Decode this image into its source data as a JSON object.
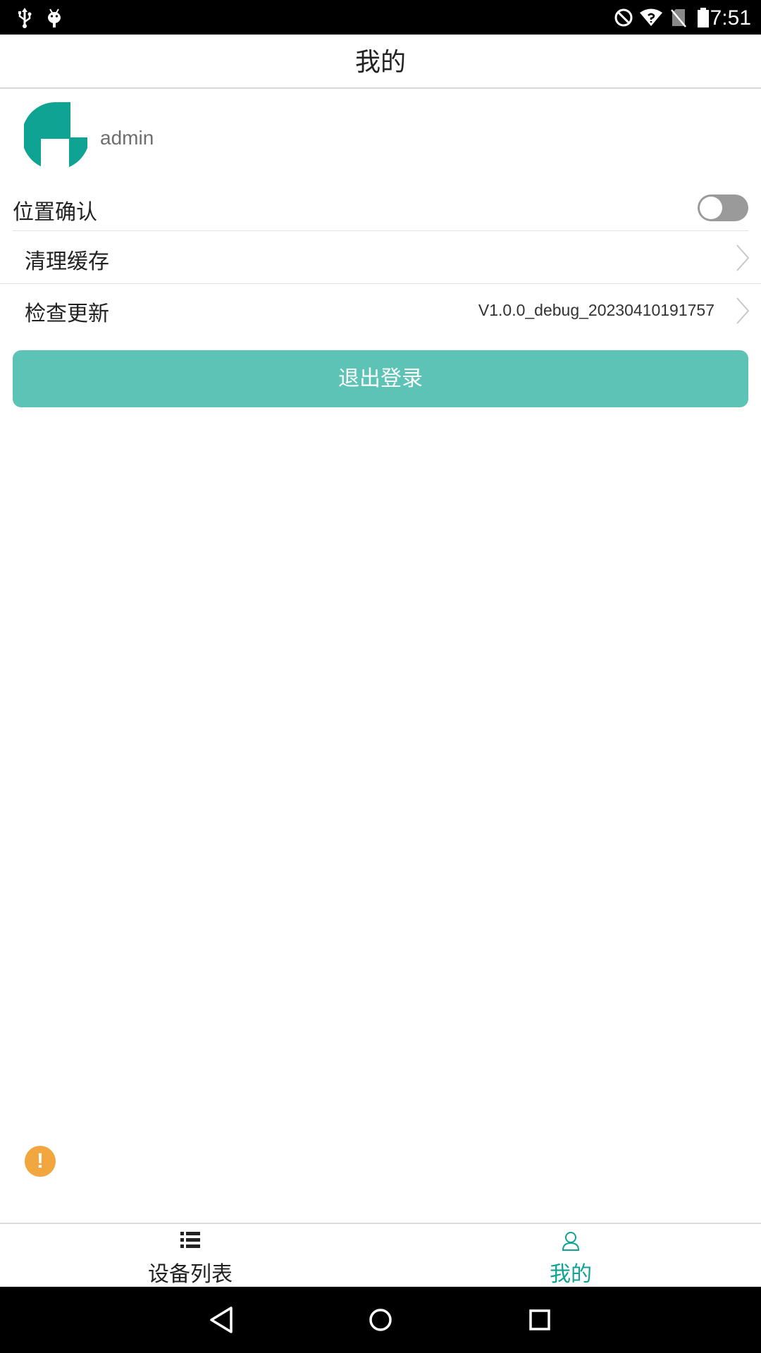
{
  "status_bar": {
    "time": "7:51",
    "left_icons": [
      "usb-icon",
      "android-debug-icon"
    ],
    "right_icons": [
      "do-not-disturb-icon",
      "wifi-icon",
      "no-sim-icon",
      "battery-icon"
    ]
  },
  "header": {
    "title": "我的"
  },
  "profile": {
    "username": "admin",
    "avatar_color": "#0fa394"
  },
  "settings": {
    "location_confirm": {
      "label": "位置确认",
      "enabled": false
    },
    "clear_cache": {
      "label": "清理缓存"
    },
    "check_update": {
      "label": "检查更新",
      "version": "V1.0.0_debug_20230410191757"
    }
  },
  "logout_button": {
    "label": "退出登录",
    "color": "#5cc3b6"
  },
  "warning_badge": {
    "symbol": "!",
    "color": "#f2a63f"
  },
  "bottom_nav": {
    "items": [
      {
        "label": "设备列表",
        "icon": "list-icon",
        "active": false
      },
      {
        "label": "我的",
        "icon": "person-icon",
        "active": true
      }
    ],
    "active_color": "#0fa394"
  },
  "system_nav": {
    "buttons": [
      "back-icon",
      "home-icon",
      "recents-icon"
    ]
  }
}
